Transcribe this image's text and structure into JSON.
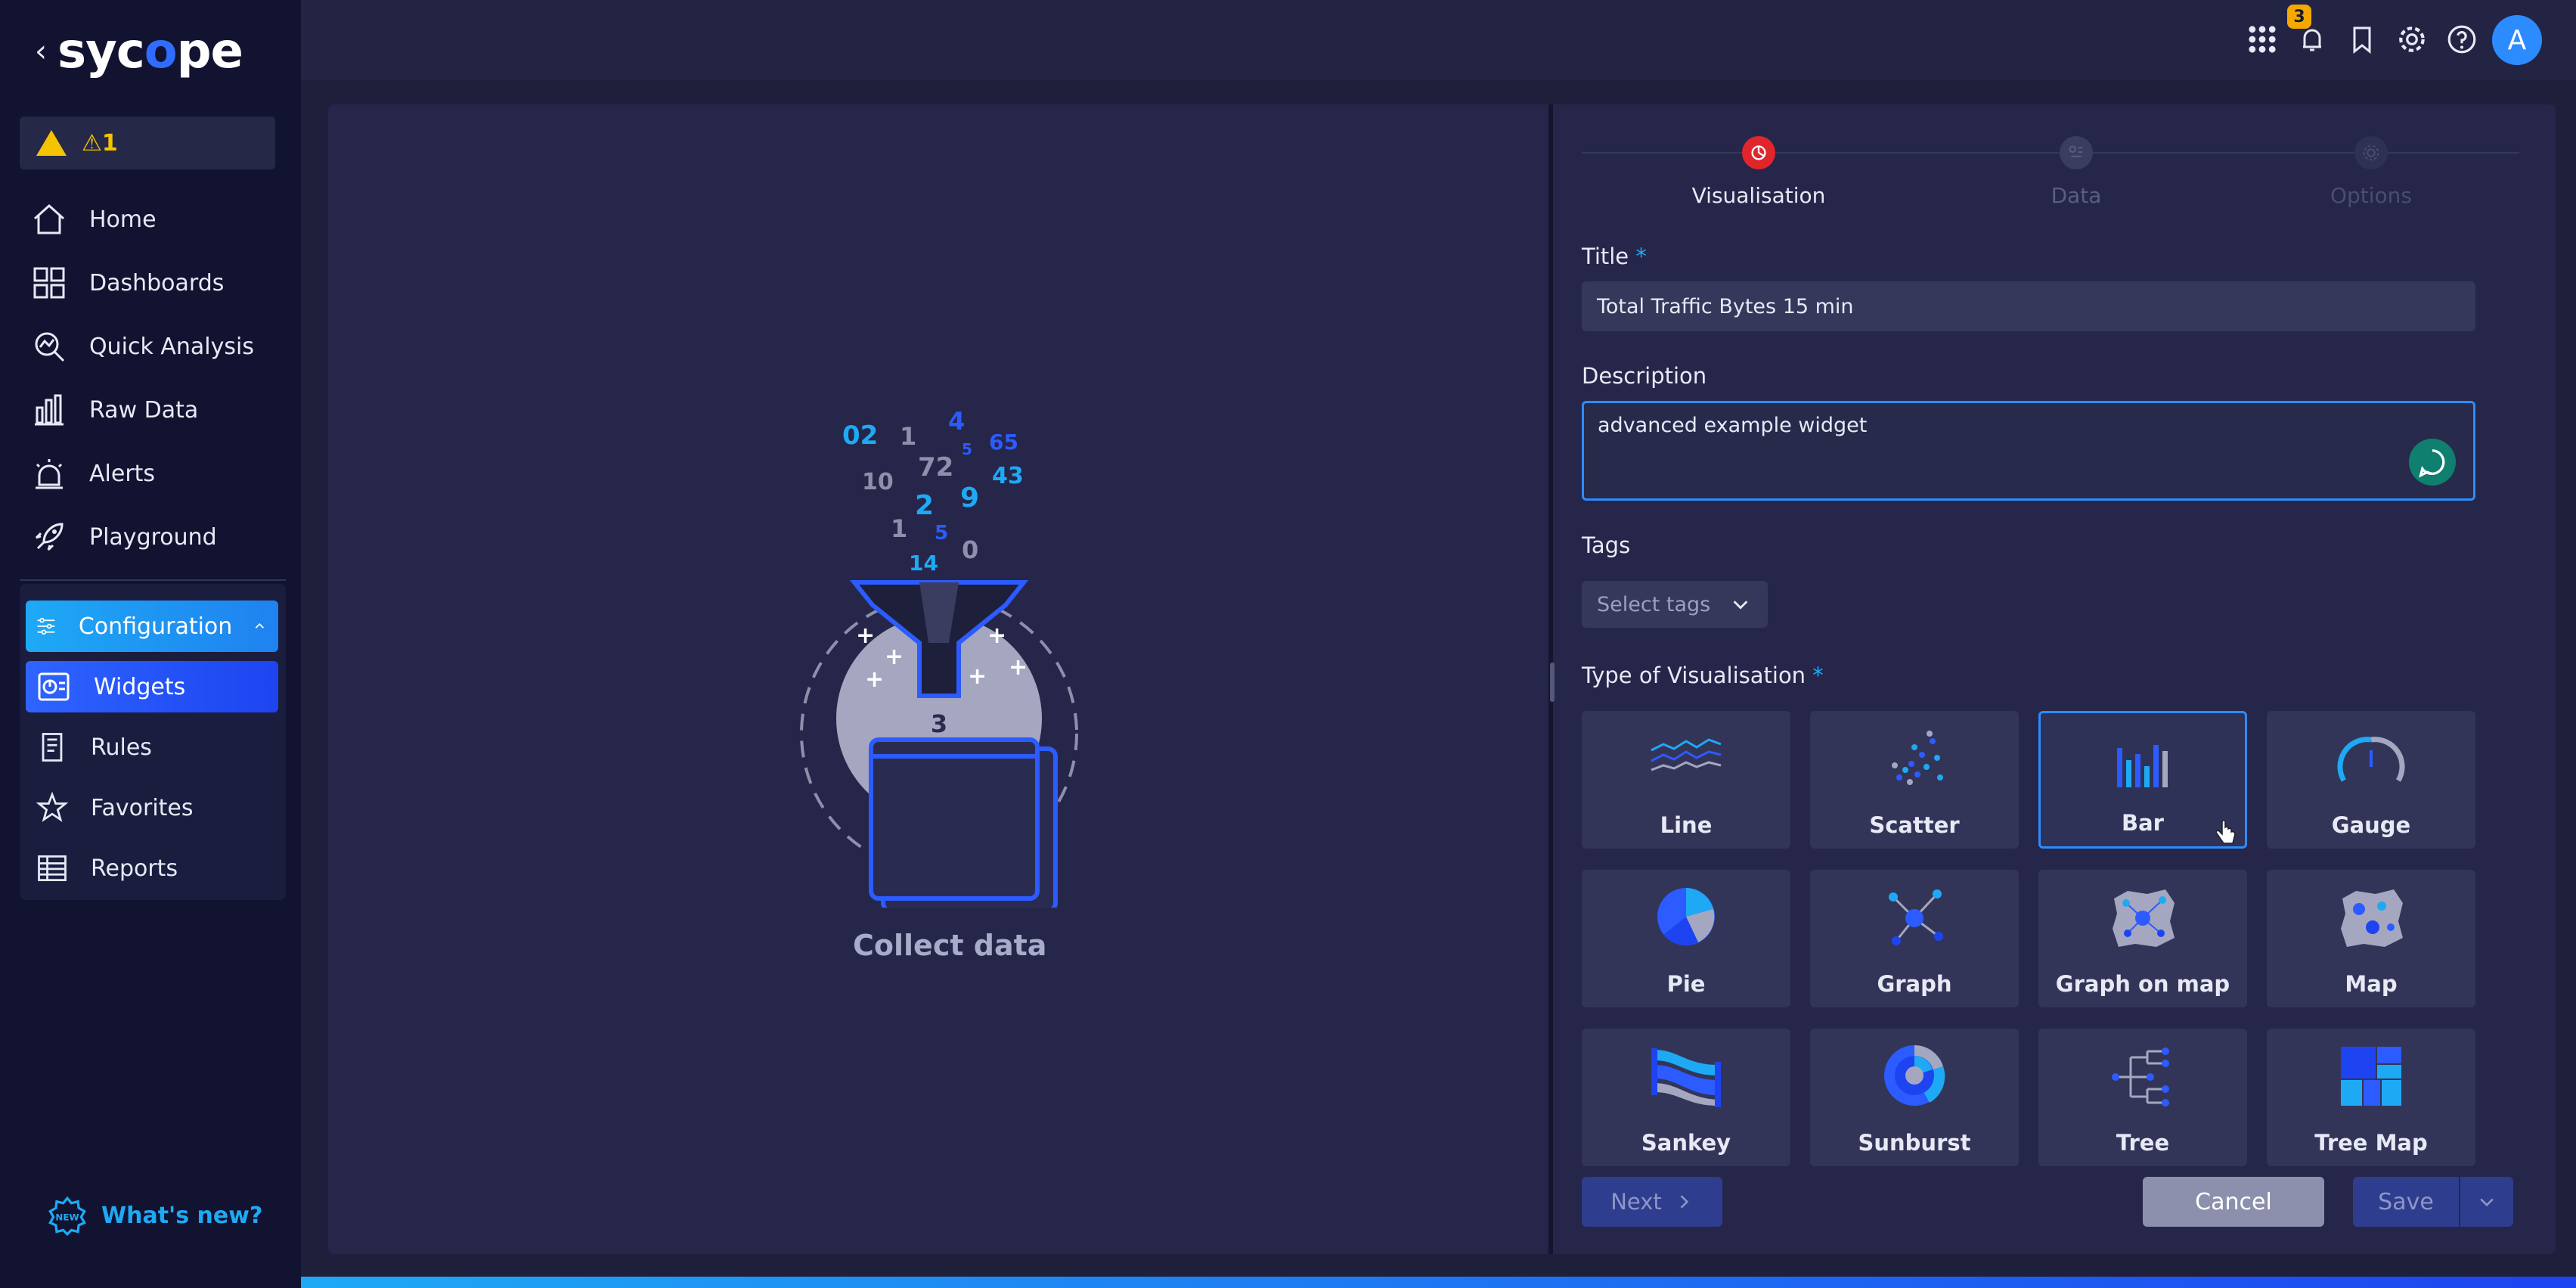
{
  "brand": {
    "name_part1": "syc",
    "name_part2": "pe"
  },
  "alert": {
    "count": "⚠1"
  },
  "nav": {
    "home": "Home",
    "dashboards": "Dashboards",
    "quick_analysis": "Quick Analysis",
    "raw_data": "Raw Data",
    "alerts": "Alerts",
    "playground": "Playground",
    "configuration": "Configuration",
    "widgets": "Widgets",
    "rules": "Rules",
    "favorites": "Favorites",
    "reports": "Reports",
    "whats_new": "What's new?"
  },
  "topbar": {
    "notification_count": "3",
    "avatar_letter": "A"
  },
  "illustration": {
    "numbers": [
      "02",
      "1",
      "4",
      "65",
      "10",
      "72",
      "5",
      "43",
      "2",
      "9",
      "1",
      "5",
      "0",
      "14",
      "3"
    ],
    "caption": "Collect data"
  },
  "stepper": {
    "steps": [
      {
        "label": "Visualisation",
        "active": true
      },
      {
        "label": "Data",
        "active": false
      },
      {
        "label": "Options",
        "active": false
      }
    ]
  },
  "form": {
    "title_label": "Title",
    "title_value": "Total Traffic Bytes 15 min",
    "description_label": "Description",
    "description_value": "advanced example widget",
    "tags_label": "Tags",
    "tags_placeholder": "Select tags",
    "type_label": "Type of Visualisation",
    "required_mark": "*",
    "types": [
      "Line",
      "Scatter",
      "Bar",
      "Gauge",
      "Pie",
      "Graph",
      "Graph on map",
      "Map",
      "Sankey",
      "Sunburst",
      "Tree",
      "Tree Map"
    ],
    "selected_type": "Bar"
  },
  "buttons": {
    "next": "Next",
    "cancel": "Cancel",
    "save": "Save"
  },
  "colors": {
    "accent": "#2c8cff",
    "active_step": "#e0262b",
    "warning": "#f5c400"
  }
}
